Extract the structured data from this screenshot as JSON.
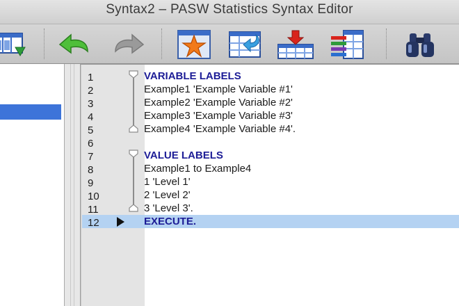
{
  "window": {
    "title": "Syntax2 – PASW Statistics Syntax Editor"
  },
  "toolbar": {
    "buttons": [
      {
        "name": "data-view-icon",
        "tooltip": ""
      },
      {
        "name": "undo-icon",
        "tooltip": ""
      },
      {
        "name": "redo-icon",
        "tooltip": ""
      },
      {
        "name": "star-icon",
        "tooltip": ""
      },
      {
        "name": "goto-case-icon",
        "tooltip": ""
      },
      {
        "name": "insert-cases-icon",
        "tooltip": ""
      },
      {
        "name": "variables-icon",
        "tooltip": ""
      },
      {
        "name": "binoculars-icon",
        "tooltip": ""
      }
    ]
  },
  "editor": {
    "current_line": 12,
    "lines": [
      {
        "num": "1",
        "text": "VARIABLE LABELS",
        "keyword": true
      },
      {
        "num": "2",
        "text": "Example1 'Example Variable #1'",
        "keyword": false
      },
      {
        "num": "3",
        "text": "Example2 'Example Variable #2'",
        "keyword": false
      },
      {
        "num": "4",
        "text": "Example3 'Example Variable #3'",
        "keyword": false
      },
      {
        "num": "5",
        "text": "Example4 'Example Variable #4'.",
        "keyword": false
      },
      {
        "num": "6",
        "text": "",
        "keyword": false
      },
      {
        "num": "7",
        "text": "VALUE LABELS",
        "keyword": true
      },
      {
        "num": "8",
        "text": "Example1 to Example4",
        "keyword": false
      },
      {
        "num": "9",
        "text": "1 'Level 1'",
        "keyword": false
      },
      {
        "num": "10",
        "text": "2 'Level 2'",
        "keyword": false
      },
      {
        "num": "11",
        "text": "3 'Level 3'.",
        "keyword": false
      },
      {
        "num": "12",
        "text": "EXECUTE.",
        "keyword": true
      }
    ]
  },
  "colors": {
    "keyword": "#1c1c96",
    "current_line_highlight": "#b4d2f2",
    "nav_selection": "#3d74d9"
  }
}
